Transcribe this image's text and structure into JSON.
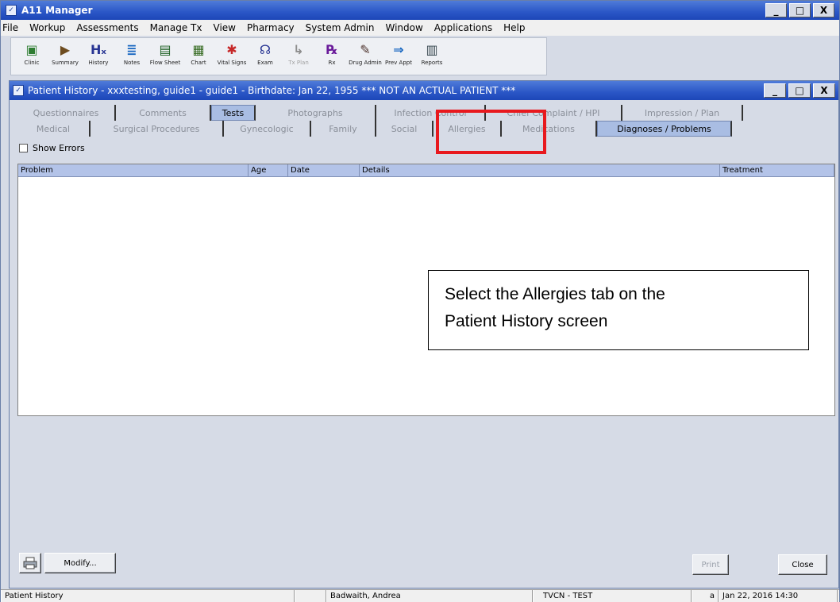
{
  "app": {
    "title": "A11 Manager",
    "controls": {
      "minimize": "_",
      "maximize": "□",
      "close": "X"
    }
  },
  "menu": [
    "File",
    "Workup",
    "Assessments",
    "Manage Tx",
    "View",
    "Pharmacy",
    "System Admin",
    "Window",
    "Applications",
    "Help"
  ],
  "toolbar": [
    {
      "label": "Clinic",
      "icon": "folder-icon",
      "glyph": "▣",
      "color": "#2e7d32"
    },
    {
      "label": "Summary",
      "icon": "folder-arrow-icon",
      "glyph": "▶",
      "color": "#6d4c1f"
    },
    {
      "label": "History",
      "icon": "hx-icon",
      "glyph": "Hₓ",
      "color": "#283593"
    },
    {
      "label": "Notes",
      "icon": "notes-icon",
      "glyph": "≣",
      "color": "#1565c0"
    },
    {
      "label": "Flow Sheet",
      "icon": "flowsheet-icon",
      "glyph": "▤",
      "color": "#1b5e20"
    },
    {
      "label": "Chart",
      "icon": "chart-icon",
      "glyph": "▦",
      "color": "#33691e"
    },
    {
      "label": "Vital Signs",
      "icon": "vitals-icon",
      "glyph": "✱",
      "color": "#c62828"
    },
    {
      "label": "Exam",
      "icon": "stethoscope-icon",
      "glyph": "☊",
      "color": "#283593"
    },
    {
      "label": "Tx Plan",
      "icon": "txplan-icon",
      "glyph": "↳",
      "color": "#8d8d8d",
      "disabled": true
    },
    {
      "label": "Rx",
      "icon": "rx-icon",
      "glyph": "℞",
      "color": "#6a1b9a"
    },
    {
      "label": "Drug Admin",
      "icon": "drug-admin-icon",
      "glyph": "✎",
      "color": "#4e342e"
    },
    {
      "label": "Prev Appt",
      "icon": "prev-appt-icon",
      "glyph": "⇒",
      "color": "#1565c0"
    },
    {
      "label": "Reports",
      "icon": "reports-icon",
      "glyph": "▥",
      "color": "#37474f"
    }
  ],
  "child": {
    "title": "Patient History - xxxtesting, guide1 - guide1 - Birthdate: Jan 22, 1955 *** NOT AN ACTUAL PATIENT ***"
  },
  "tabs_row1": [
    "Questionnaires",
    "Comments",
    "Tests",
    "Photographs",
    "Infection Control",
    "Chief Complaint / HPI",
    "Impression / Plan"
  ],
  "tabs_row2": [
    "Medical",
    "Surgical Procedures",
    "Gynecologic",
    "Family",
    "Social",
    "Allergies",
    "Medications",
    "Diagnoses / Problems"
  ],
  "show_errors": "Show Errors",
  "grid_columns": [
    "Problem",
    "Age",
    "Date",
    "Details",
    "Treatment"
  ],
  "callout": {
    "line1": "Select the Allergies tab on the",
    "line2": "Patient History screen"
  },
  "buttons": {
    "modify": "Modify...",
    "print": "Print",
    "close": "Close"
  },
  "status": {
    "screen": "Patient History",
    "user": "Badwaith, Andrea",
    "env": "TVCN - TEST",
    "datetime": "Jan 22, 2016 14:30",
    "indicator": "a"
  },
  "colors": {
    "title_bar": "#2a56c6",
    "tab_active": "#a9bde3",
    "annotation": "#e8191e"
  }
}
